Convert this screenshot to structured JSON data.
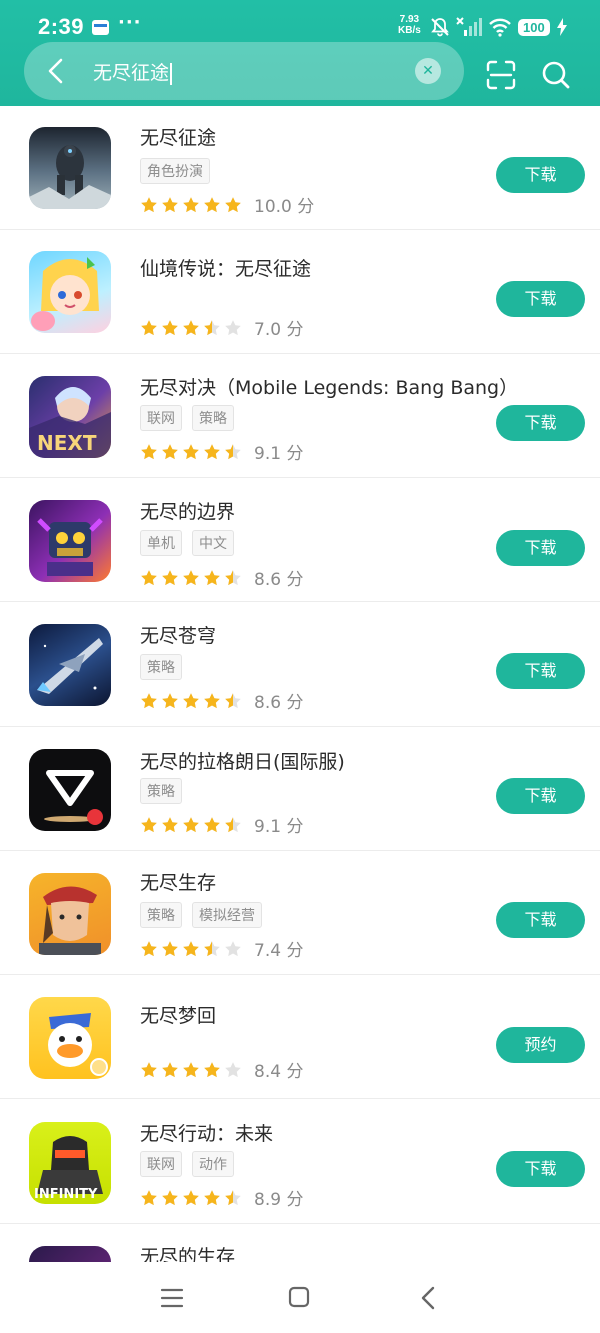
{
  "status_bar": {
    "time": "2:39",
    "net_speed_value": "7.93",
    "net_speed_unit": "KB/s",
    "battery": "100",
    "icons": [
      "app-notification-icon",
      "more-dots-icon",
      "mute-bell-icon",
      "no-signal-icon",
      "wifi-icon",
      "charging-bolt-icon"
    ]
  },
  "search": {
    "query": "无尽征途",
    "icons": [
      "back-arrow-icon",
      "clear-icon",
      "scan-icon",
      "search-icon"
    ]
  },
  "colors": {
    "accent": "#1fb69c",
    "star_on": "#f6b51c",
    "star_off": "#e2e2e2"
  },
  "results": [
    {
      "name": "无尽征途",
      "tags": [
        "角色扮演"
      ],
      "stars": 5,
      "score": "10.0 分",
      "button": "下载",
      "icon": "giant-titan-game-icon"
    },
    {
      "name": "仙境传说：无尽征途",
      "tags": [],
      "stars": 3.5,
      "score": "7.0 分",
      "button": "下载",
      "icon": "anime-girl-game-icon"
    },
    {
      "name": "无尽对决（Mobile Legends: Bang Bang）",
      "tags": [
        "联网",
        "策略"
      ],
      "stars": 4.5,
      "score": "9.1 分",
      "button": "下载",
      "icon": "mlbb-next-game-icon"
    },
    {
      "name": "无尽的边界",
      "tags": [
        "单机",
        "中文"
      ],
      "stars": 4.5,
      "score": "8.6 分",
      "button": "下载",
      "icon": "mech-robot-game-icon"
    },
    {
      "name": "无尽苍穹",
      "tags": [
        "策略"
      ],
      "stars": 4.5,
      "score": "8.6 分",
      "button": "下载",
      "icon": "spaceship-game-icon"
    },
    {
      "name": "无尽的拉格朗日(国际服)",
      "tags": [
        "策略"
      ],
      "stars": 4.5,
      "score": "9.1 分",
      "button": "下载",
      "icon": "lagrange-logo-game-icon"
    },
    {
      "name": "无尽生存",
      "tags": [
        "策略",
        "模拟经营"
      ],
      "stars": 3.5,
      "score": "7.4 分",
      "button": "下载",
      "icon": "survivor-woman-game-icon"
    },
    {
      "name": "无尽梦回",
      "tags": [],
      "stars": 4,
      "score": "8.4 分",
      "button": "预约",
      "icon": "cartoon-duck-game-icon"
    },
    {
      "name": "无尽行动：未来",
      "tags": [
        "联网",
        "动作"
      ],
      "stars": 4.5,
      "score": "8.9 分",
      "button": "下载",
      "icon": "infinity-ops-game-icon"
    },
    {
      "name": "无尽的生存",
      "tags": [],
      "stars": 0,
      "score": "",
      "button": "",
      "icon": "purple-game-icon"
    }
  ],
  "nav": {
    "icons": [
      "menu-icon",
      "home-icon",
      "back-icon"
    ]
  }
}
